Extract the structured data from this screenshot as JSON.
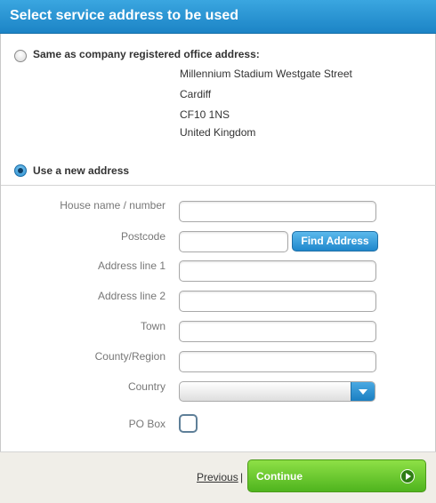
{
  "header": {
    "title": "Select service address to be used"
  },
  "option_registered": {
    "label": "Same as company registered office address:",
    "selected": false,
    "address_lines": [
      "Millennium Stadium Westgate Street",
      "Cardiff",
      "CF10 1NS",
      "United Kingdom"
    ]
  },
  "option_new": {
    "label": "Use a new address",
    "selected": true
  },
  "form": {
    "house_label": "House name / number",
    "house_value": "",
    "postcode_label": "Postcode",
    "postcode_value": "",
    "find_address_label": "Find Address",
    "address1_label": "Address line 1",
    "address1_value": "",
    "address2_label": "Address line 2",
    "address2_value": "",
    "town_label": "Town",
    "town_value": "",
    "county_label": "County/Region",
    "county_value": "",
    "country_label": "Country",
    "country_value": "",
    "pobox_label": "PO Box",
    "pobox_checked": false
  },
  "footer": {
    "previous_label": "Previous",
    "separator": "|",
    "continue_label": "Continue"
  },
  "colors": {
    "header_blue": "#1c84c6",
    "button_blue": "#1f87cc",
    "continue_green": "#4fb41e",
    "footer_bg": "#f0eee8"
  }
}
